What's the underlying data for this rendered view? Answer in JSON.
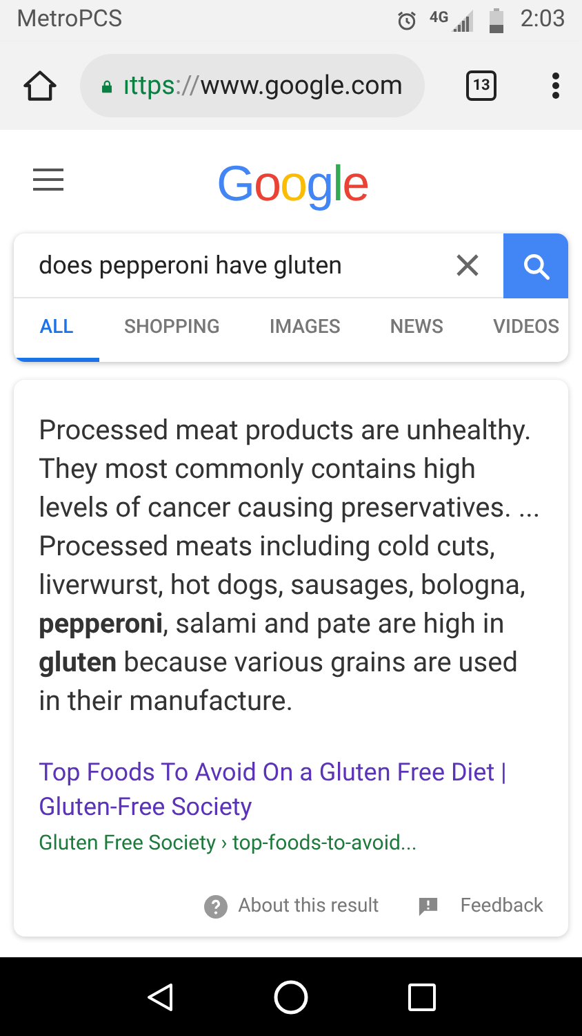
{
  "status_bar": {
    "carrier": "MetroPCS",
    "network": "4G",
    "time": "2:03"
  },
  "browser": {
    "url_scheme": "ıttps",
    "url_separator": "://",
    "url_host": "www.google.com",
    "tab_count": "13"
  },
  "header": {
    "logo": "Google"
  },
  "search": {
    "query": "does pepperoni have gluten"
  },
  "tabs": [
    {
      "label": "ALL",
      "selected": true
    },
    {
      "label": "SHOPPING",
      "selected": false
    },
    {
      "label": "IMAGES",
      "selected": false
    },
    {
      "label": "NEWS",
      "selected": false
    },
    {
      "label": "VIDEOS",
      "selected": false
    }
  ],
  "result": {
    "snippet": "Processed meat products are unhealthy. They most commonly contains high levels of cancer causing preservatives. ... Processed meats including cold cuts, liverwurst, hot dogs, sausages, bologna, **pepperoni**, salami and pate are high in **gluten** because various grains are used in their manufacture.",
    "title": "Top Foods To Avoid On a Gluten Free Diet | Gluten-Free Society",
    "breadcrumb": "Gluten Free Society › top-foods-to-avoid...",
    "about": "About this result",
    "feedback": "Feedback"
  }
}
